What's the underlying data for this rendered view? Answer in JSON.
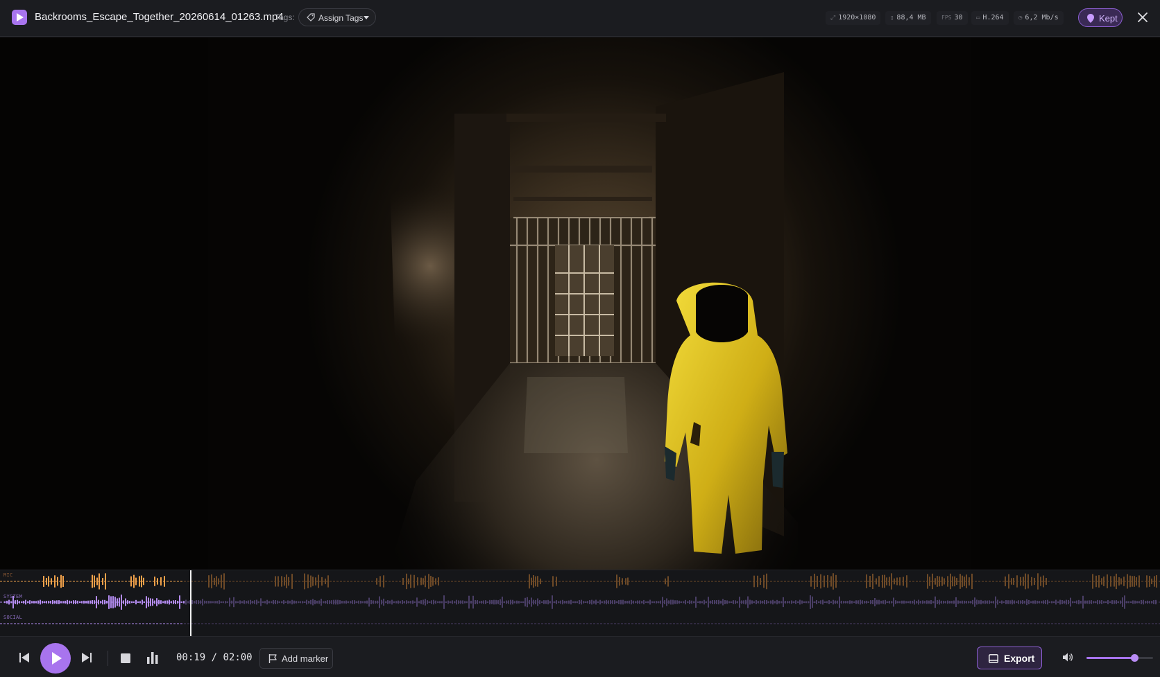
{
  "header": {
    "filename": "Backrooms_Escape_Together_20260614_01263.mp4",
    "tags_label": "Tags:",
    "assign_tags_label": "Assign Tags",
    "meta": {
      "resolution": "1920×1080",
      "size": "88,4 MB",
      "fps_label": "FPS",
      "fps": "30",
      "codec": "H.264",
      "bitrate": "6,2 Mb/s"
    },
    "kept_label": "Kept"
  },
  "tracks": {
    "mic_label": "MIC",
    "system_label": "SYSTEM",
    "social_label": "SOCIAL",
    "played_fraction": 0.1583
  },
  "controls": {
    "time_current": "00:19",
    "time_separator": "/",
    "time_total": "02:00",
    "add_marker_label": "Add marker",
    "export_label": "Export",
    "volume": 0.72
  },
  "colors": {
    "accent": "#a874ee",
    "mic_active": "#f0a14a",
    "mic_dim": "#6e4a27",
    "system_active": "#b48cf2",
    "system_dim": "#4a3e66"
  },
  "icons": [
    "app-play-icon",
    "tag-icon",
    "caret-down-icon",
    "resolution-icon",
    "file-icon",
    "codec-icon",
    "bitrate-icon",
    "pin-icon",
    "close-icon",
    "skip-back-icon",
    "play-icon",
    "skip-forward-icon",
    "stop-icon",
    "waveform-toggle-icon",
    "flag-icon",
    "export-icon",
    "volume-icon"
  ]
}
